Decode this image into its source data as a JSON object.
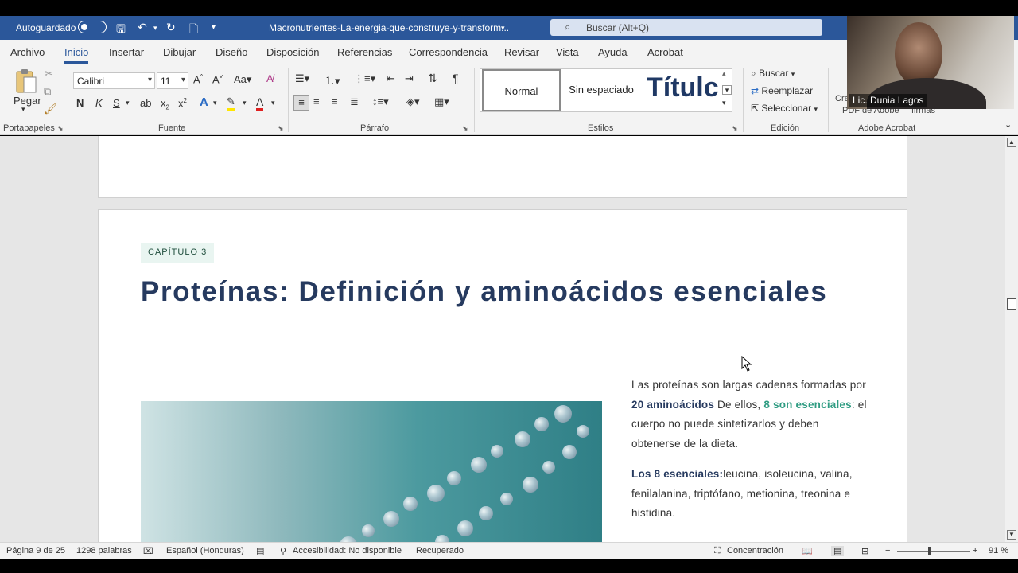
{
  "titlebar": {
    "autosave_label": "Autoguardado",
    "document_title": "Macronutrientes-La-energia-que-construye-y-transform...",
    "search_placeholder": "Buscar (Alt+Q)"
  },
  "menu": [
    "Archivo",
    "Inicio",
    "Insertar",
    "Dibujar",
    "Diseño",
    "Disposición",
    "Referencias",
    "Correspondencia",
    "Revisar",
    "Vista",
    "Ayuda",
    "Acrobat"
  ],
  "ribbon": {
    "clipboard": {
      "paste_label": "Pegar",
      "group_label": "Portapapeles"
    },
    "font": {
      "font_name": "Calibri",
      "font_size": "11",
      "group_label": "Fuente"
    },
    "paragraph": {
      "group_label": "Párrafo"
    },
    "styles": {
      "items": [
        "Normal",
        "Sin espaciado",
        "Títulc"
      ],
      "group_label": "Estilos"
    },
    "editing": {
      "find": "Buscar",
      "replace": "Reemplazar",
      "select": "Seleccionar",
      "group_label": "Edición"
    },
    "acrobat": {
      "create_pdf_line1": "Cre",
      "create_pdf_line2": "PDF de Adobe",
      "firmas": "firmas",
      "group_label": "Adobe Acrobat"
    }
  },
  "video": {
    "participant_name": "Lic. Dunia Lagos"
  },
  "document": {
    "chapter_label": "CAPÍTULO 3",
    "heading": "Proteínas: Definición y aminoácidos esenciales",
    "para1_intro": "Las proteínas son largas cadenas formadas por ",
    "para1_bold": "20 aminoácidos",
    "para1_mid": " De ellos, ",
    "para1_green": "8 son esenciales",
    "para1_end": ": el cuerpo no puede sintetizarlos y deben obtenerse de la dieta.",
    "para2_bold": "Los 8 esenciales:",
    "para2_text": "leucina, isoleucina, valina, fenilalanina, triptófano, metionina, treonina e histidina."
  },
  "status": {
    "page": "Página 9 de 25",
    "words": "1298 palabras",
    "language": "Español (Honduras)",
    "accessibility": "Accesibilidad: No disponible",
    "recovered": "Recuperado",
    "focus": "Concentración",
    "zoom": "91 %"
  },
  "colors": {
    "titlebar": "#2b579a",
    "heading": "#263a5f",
    "accent_green": "#2f9c82"
  }
}
